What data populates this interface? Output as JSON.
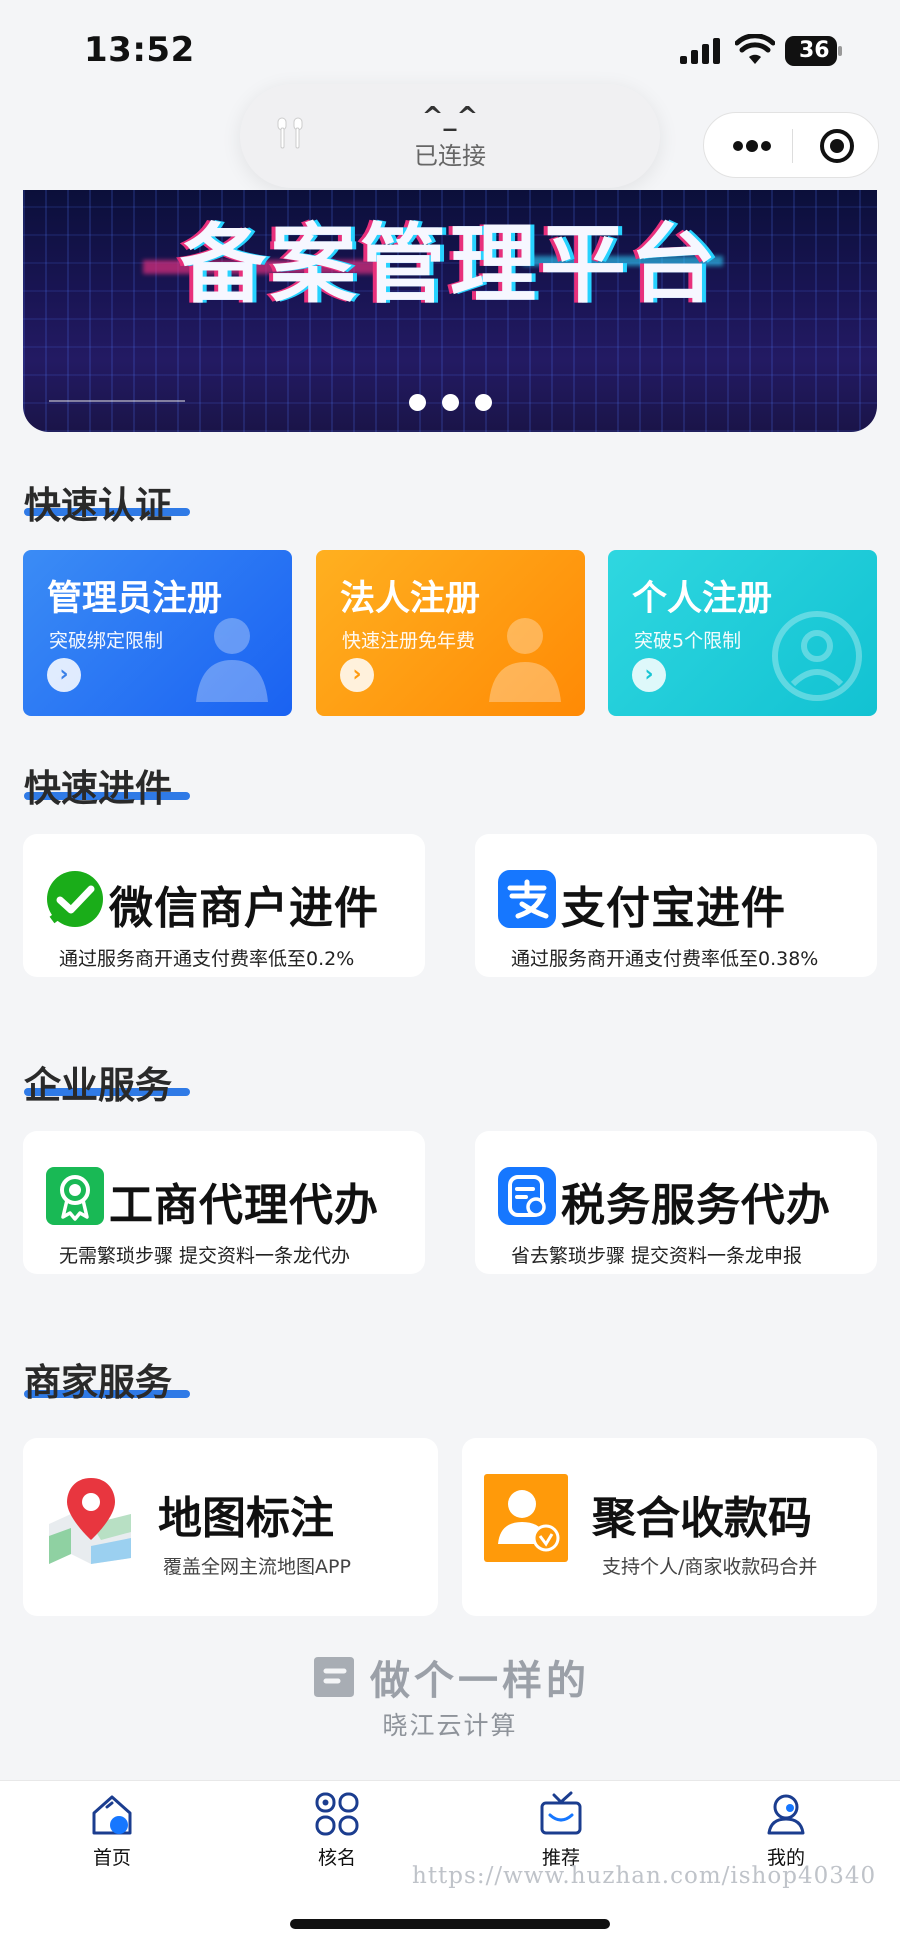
{
  "status_bar": {
    "time": "13:52",
    "battery": "36"
  },
  "island": {
    "face": "^_^",
    "status": "已连接"
  },
  "banner": {
    "title": "备案管理平台"
  },
  "sections": {
    "quick_auth": "快速认证",
    "quick_entry": "快速进件",
    "enterprise": "企业服务",
    "merchant": "商家服务"
  },
  "auth_cards": [
    {
      "title": "管理员注册",
      "subtitle": "突破绑定限制"
    },
    {
      "title": "法人注册",
      "subtitle": "快速注册免年费"
    },
    {
      "title": "个人注册",
      "subtitle": "突破5个限制"
    }
  ],
  "entry_cards": [
    {
      "title": "微信商户进件",
      "subtitle": "通过服务商开通支付费率低至0.2%"
    },
    {
      "title": "支付宝进件",
      "subtitle": "通过服务商开通支付费率低至0.38%"
    }
  ],
  "enterprise_cards": [
    {
      "title": "工商代理代办",
      "subtitle": "无需繁琐步骤 提交资料一条龙代办"
    },
    {
      "title": "税务服务代办",
      "subtitle": "省去繁琐步骤 提交资料一条龙申报"
    }
  ],
  "merchant_cards": [
    {
      "title": "地图标注",
      "subtitle": "覆盖全网主流地图APP"
    },
    {
      "title": "聚合收款码",
      "subtitle": "支持个人/商家收款码合并"
    }
  ],
  "brand": {
    "slogan": "做个一样的",
    "name": "晓江云计算"
  },
  "tabs": [
    {
      "label": "首页",
      "icon": "home-icon"
    },
    {
      "label": "核名",
      "icon": "grid-icon"
    },
    {
      "label": "推荐",
      "icon": "tv-icon"
    },
    {
      "label": "我的",
      "icon": "user-icon"
    }
  ],
  "watermark": "https://www.huzhan.com/ishop40340",
  "colors": {
    "accent_blue": "#2f7ae6",
    "admin_card": "#1a62f2",
    "legal_card": "#ff8a05",
    "personal_card": "#12c2d2",
    "wechat_green": "#1aad19",
    "alipay_blue": "#1677ff"
  }
}
